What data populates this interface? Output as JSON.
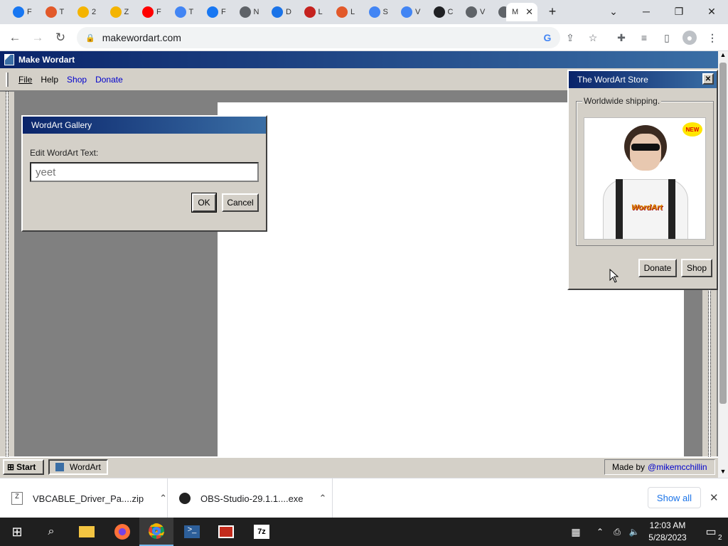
{
  "browser": {
    "tabs": [
      {
        "letter": "F",
        "color": "#1877f2"
      },
      {
        "letter": "T",
        "color": "#e2592a"
      },
      {
        "letter": "2",
        "color": "#f4b400"
      },
      {
        "letter": "Z",
        "color": "#f4b400"
      },
      {
        "letter": "F",
        "color": "#ff0000"
      },
      {
        "letter": "T",
        "color": "#4285f4"
      },
      {
        "letter": "F",
        "color": "#1877f2"
      },
      {
        "letter": "N",
        "color": "#5f6368"
      },
      {
        "letter": "D",
        "color": "#1a73e8"
      },
      {
        "letter": "L",
        "color": "#c5221f"
      },
      {
        "letter": "L",
        "color": "#e2592a"
      },
      {
        "letter": "S",
        "color": "#4285f4"
      },
      {
        "letter": "V",
        "color": "#4285f4"
      },
      {
        "letter": "C",
        "color": "#202124"
      },
      {
        "letter": "V",
        "color": "#5f6368"
      },
      {
        "letter": "V",
        "color": "#5f6368"
      }
    ],
    "active_tab_label": "M",
    "url": "makewordart.com"
  },
  "app": {
    "title": "Make Wordart",
    "menu": {
      "file": "File",
      "help": "Help",
      "shop": "Shop",
      "donate": "Donate"
    }
  },
  "gallery_dialog": {
    "title": "WordArt Gallery",
    "label": "Edit WordArt Text:",
    "placeholder": "yeet",
    "ok": "OK",
    "cancel": "Cancel"
  },
  "store": {
    "title": "The WordArt Store",
    "group_label": "Worldwide shipping.",
    "badge": "NEW",
    "shirt_text": "WordArt",
    "donate": "Donate",
    "shop": "Shop"
  },
  "app_taskbar": {
    "start": "Start",
    "item": "WordArt",
    "made_by": "Made by",
    "handle": "@mikemcchillin"
  },
  "downloads": {
    "items": [
      "VBCABLE_Driver_Pa....zip",
      "OBS-Studio-29.1.1....exe"
    ],
    "show_all": "Show all"
  },
  "system_tray": {
    "time": "12:03 AM",
    "date": "5/28/2023",
    "notifications": "2"
  },
  "colors": {
    "accent": "#0a246a",
    "chrome": "#dee1e6",
    "win95": "#d4d0c8"
  }
}
